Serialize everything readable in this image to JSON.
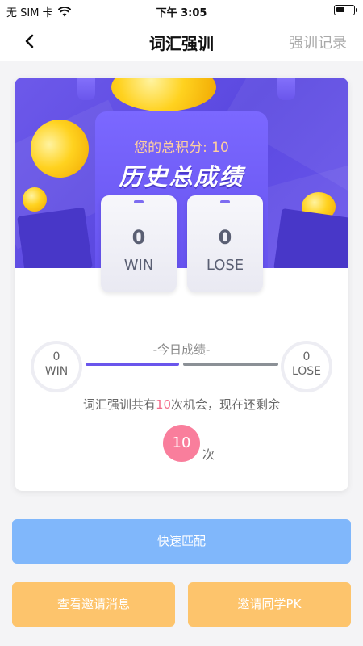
{
  "status_bar": {
    "carrier": "无 SIM 卡",
    "time": "下午 3:05",
    "wifi_icon": "wifi-icon",
    "battery_icon": "battery-icon",
    "battery_level": 0.45
  },
  "nav": {
    "back_icon": "chevron-left-icon",
    "title": "词汇强训",
    "right_link": "强训记录"
  },
  "banner": {
    "total_score_label": "您的总积分: 10",
    "history_title": "历史总成绩",
    "win": {
      "value": "0",
      "label": "WIN"
    },
    "lose": {
      "value": "0",
      "label": "LOSE"
    }
  },
  "today": {
    "label": "-今日成绩-",
    "win": {
      "value": "0",
      "label": "WIN"
    },
    "lose": {
      "value": "0",
      "label": "LOSE"
    },
    "chances_prefix": "词汇强训共有",
    "chances_total": "10",
    "chances_suffix": "次机会，现在还剩余",
    "remaining": "10",
    "remaining_unit": "次"
  },
  "buttons": {
    "quick_match": "快速匹配",
    "view_invites": "查看邀请消息",
    "invite_pk": "邀请同学PK"
  },
  "colors": {
    "banner_purple": "#6a56ec",
    "score_orange": "#ffcf9e",
    "highlight_pink": "#f36a8a",
    "match_blue": "#80b7fb",
    "action_yellow": "#fdc46c"
  }
}
